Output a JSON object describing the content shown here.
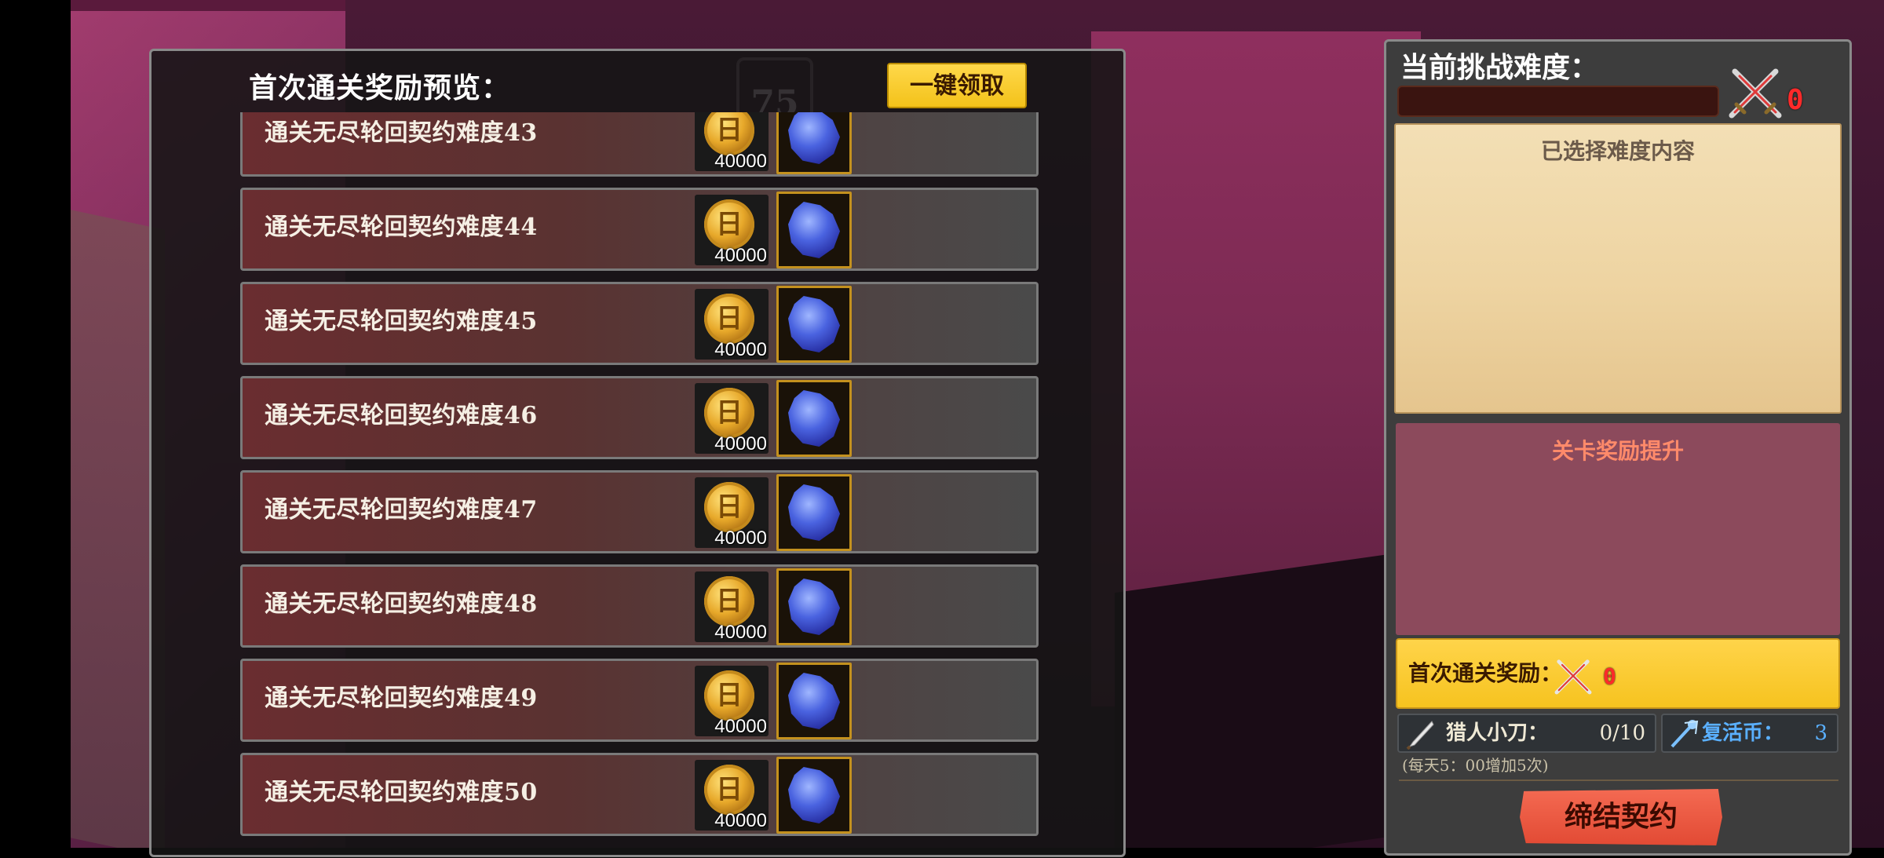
{
  "left_panel": {
    "title": "首次通关奖励预览：",
    "watermark_level": "75",
    "claim_all_button": "一键领取",
    "rows": [
      {
        "label": "通关无尽轮回契约难度43",
        "coin_symbol": "日",
        "coin_qty": "40000"
      },
      {
        "label": "通关无尽轮回契约难度44",
        "coin_symbol": "日",
        "coin_qty": "40000"
      },
      {
        "label": "通关无尽轮回契约难度45",
        "coin_symbol": "日",
        "coin_qty": "40000"
      },
      {
        "label": "通关无尽轮回契约难度46",
        "coin_symbol": "日",
        "coin_qty": "40000"
      },
      {
        "label": "通关无尽轮回契约难度47",
        "coin_symbol": "日",
        "coin_qty": "40000"
      },
      {
        "label": "通关无尽轮回契约难度48",
        "coin_symbol": "日",
        "coin_qty": "40000"
      },
      {
        "label": "通关无尽轮回契约难度49",
        "coin_symbol": "日",
        "coin_qty": "40000"
      },
      {
        "label": "通关无尽轮回契约难度50",
        "coin_symbol": "日",
        "coin_qty": "40000"
      }
    ]
  },
  "right_panel": {
    "title": "当前挑战难度：",
    "difficulty_count": "0",
    "selected_content_title": "已选择难度内容",
    "stage_bonus_title": "关卡奖励提升",
    "first_clear_label": "首次通关奖励：",
    "first_clear_count": "0",
    "hunter_knife_label": "猎人小刀：",
    "hunter_knife_value": "0/10",
    "revive_coin_label": "复活币：",
    "revive_coin_value": "3",
    "daily_note": "(每天5：00增加5次)",
    "contract_button": "缔结契约"
  },
  "colors": {
    "accent_yellow": "#f6c31f",
    "count_red": "#ff2a2a",
    "revive_blue": "#5ab0ff",
    "contract_red": "#e24a34"
  },
  "icons": [
    "coin-icon",
    "blue-crystal-icon",
    "crossed-swords-icon",
    "knife-icon",
    "revive-staff-icon"
  ]
}
